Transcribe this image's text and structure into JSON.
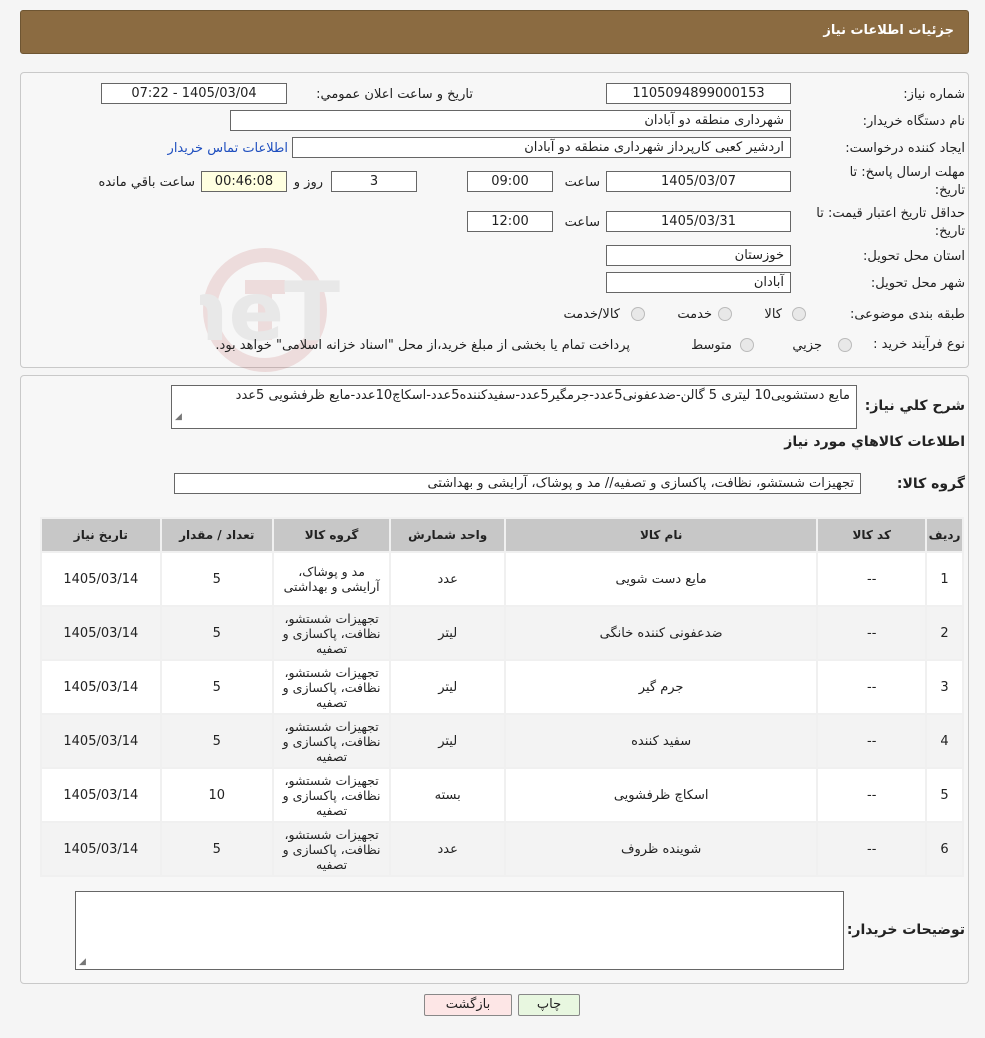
{
  "header": {
    "title": "جزئیات اطلاعات نیاز"
  },
  "form": {
    "need_number_label": "شماره نیاز:",
    "need_number": "1105094899000153",
    "announce_label": "تاریخ و ساعت اعلان عمومي:",
    "announce_value": "1405/03/04 - 07:22",
    "buyer_label": "نام دستگاه خریدار:",
    "buyer_value": "شهرداری منطقه دو آبادان",
    "requester_label": "ایجاد کننده درخواست:",
    "requester_value": "اردشیر کعبی کارپرداز شهرداری منطقه دو آبادان",
    "contact_link": "اطلاعات تماس خریدار",
    "deadline_label": "مهلت ارسال پاسخ: تا تاریخ:",
    "deadline_date": "1405/03/07",
    "time_label": "ساعت",
    "deadline_time": "09:00",
    "days_value": "3",
    "days_label": "روز و",
    "remaining_value": "00:46:08",
    "remaining_label": "ساعت باقي مانده",
    "validity_label": "حداقل تاریخ اعتبار قیمت: تا تاریخ:",
    "validity_date": "1405/03/31",
    "validity_time": "12:00",
    "province_label": "استان محل تحویل:",
    "province_value": "خوزستان",
    "city_label": "شهر محل تحویل:",
    "city_value": "آبادان",
    "category_label": "طبقه بندی موضوعی:",
    "category_options": [
      "کالا",
      "خدمت",
      "کالا/خدمت"
    ],
    "process_label": "نوع فرآیند خرید :",
    "process_options": [
      "جزیي",
      "متوسط"
    ],
    "process_note": "پرداخت تمام یا بخشی از مبلغ خرید،از محل \"اسناد خزانه اسلامی\" خواهد بود."
  },
  "details": {
    "summary_label": "شرح کلي نیاز:",
    "summary_value": "مایع دستشویی10 لیتری 5 گالن-ضدعفونی5عدد-جرمگیر5عدد-سفیدکننده5عدد-اسکاچ10عدد-مایع ظرفشویی 5عدد",
    "goods_info_title": "اطلاعات کالاهاي مورد نیاز",
    "goods_group_label": "گروه کالا:",
    "goods_group_value": "تجهیزات شستشو، نظافت، پاکسازی و تصفیه// مد و پوشاک، آرایشی و بهداشتی",
    "buyer_notes_label": "توضیحات خریدار:"
  },
  "table": {
    "headers": [
      "ردیف",
      "کد کالا",
      "نام کالا",
      "واحد شمارش",
      "گروه کالا",
      "تعداد / مقدار",
      "تاریخ نیاز"
    ],
    "rows": [
      [
        "1",
        "--",
        "مایع دست شویی",
        "عدد",
        "مد و پوشاک، آرایشی و بهداشتی",
        "5",
        "1405/03/14"
      ],
      [
        "2",
        "--",
        "ضدعفونی کننده خانگی",
        "لیتر",
        "تجهیزات شستشو، نظافت، پاکسازی و تصفیه",
        "5",
        "1405/03/14"
      ],
      [
        "3",
        "--",
        "جرم گیر",
        "لیتر",
        "تجهیزات شستشو، نظافت، پاکسازی و تصفیه",
        "5",
        "1405/03/14"
      ],
      [
        "4",
        "--",
        "سفید کننده",
        "لیتر",
        "تجهیزات شستشو، نظافت، پاکسازی و تصفیه",
        "5",
        "1405/03/14"
      ],
      [
        "5",
        "--",
        "اسکاچ ظرفشویی",
        "بسته",
        "تجهیزات شستشو، نظافت، پاکسازی و تصفیه",
        "10",
        "1405/03/14"
      ],
      [
        "6",
        "--",
        "شوینده ظروف",
        "عدد",
        "تجهیزات شستشو، نظافت، پاکسازی و تصفیه",
        "5",
        "1405/03/14"
      ]
    ]
  },
  "buttons": {
    "print": "چاپ",
    "back": "بازگشت"
  },
  "watermark": {
    "text": "AriaTender.neT"
  },
  "colors": {
    "header_bg": "#8b6b41",
    "link": "#1f4fbf",
    "print_bg": "#e8f7e0",
    "back_bg": "#fde6e6"
  }
}
